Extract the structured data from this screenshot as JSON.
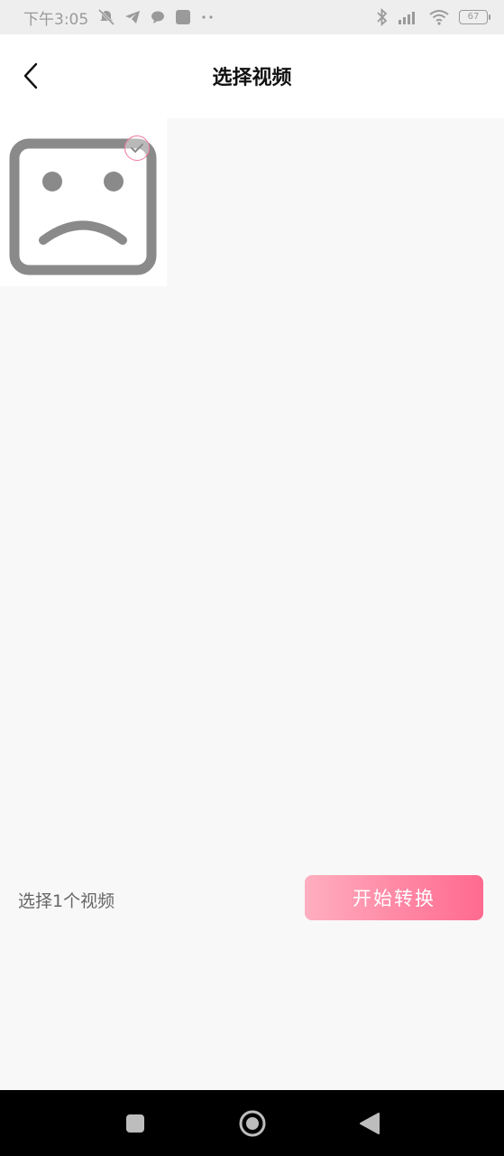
{
  "status_bar": {
    "time": "下午3:05",
    "battery": "67"
  },
  "header": {
    "title": "选择视频"
  },
  "videos": [
    {
      "state": "load-failed",
      "selected": true
    }
  ],
  "footer": {
    "selection_count": "选择1个视频",
    "start_button_label": "开始转换"
  },
  "colors": {
    "accent": "#ff7a9a",
    "background": "#f8f8f8",
    "placeholder_gray": "#8a8a8a"
  }
}
